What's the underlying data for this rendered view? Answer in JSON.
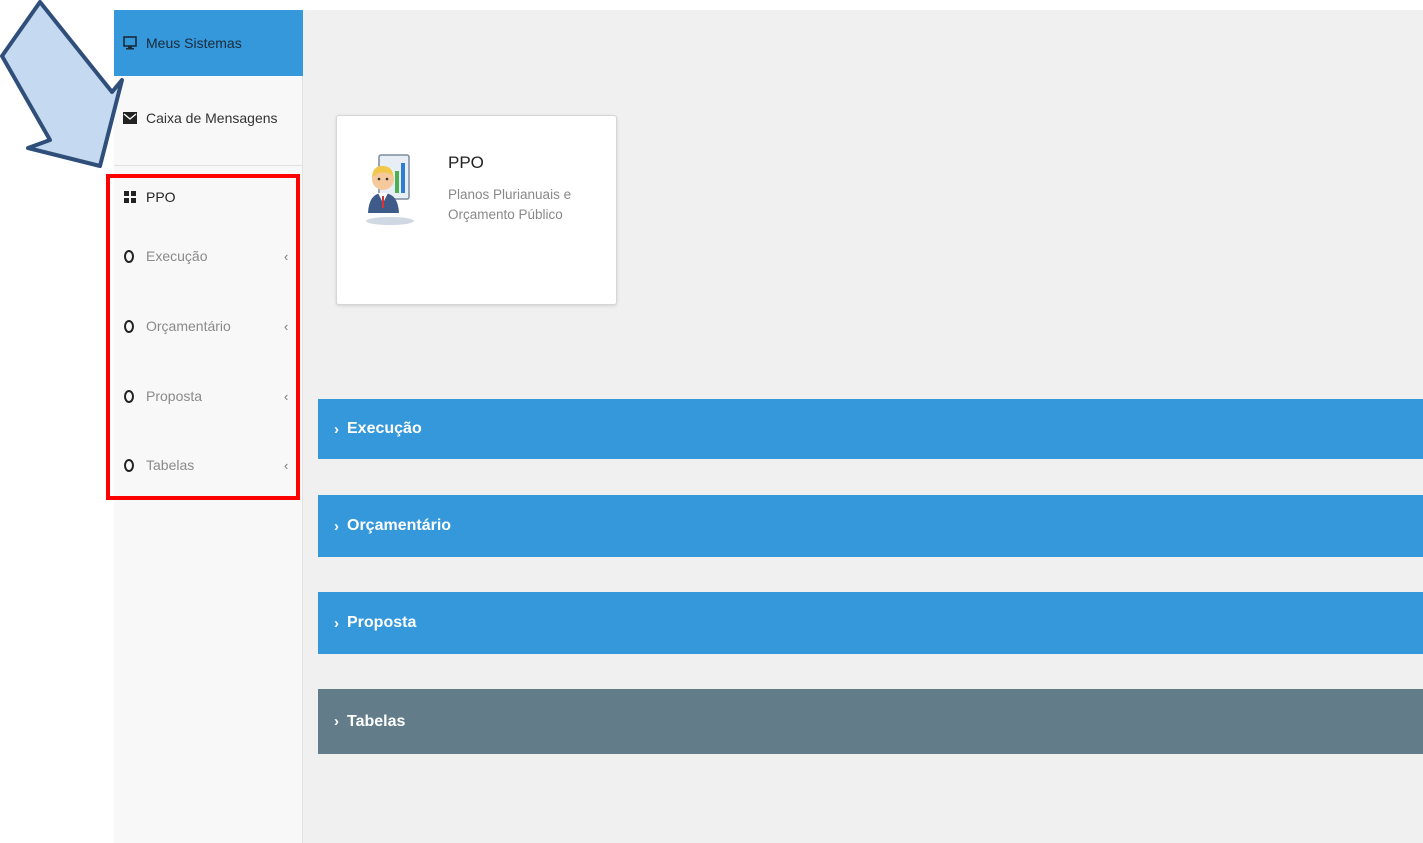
{
  "sidebar": {
    "meus_sistemas": "Meus Sistemas",
    "caixa_mensagens": "Caixa de Mensagens",
    "ppo": "PPO",
    "items": [
      {
        "label": "Execução"
      },
      {
        "label": "Orçamentário"
      },
      {
        "label": "Proposta"
      },
      {
        "label": "Tabelas"
      }
    ]
  },
  "card": {
    "title": "PPO",
    "description": "Planos Plurianuais e Orçamento Público"
  },
  "sections": [
    {
      "label": "Execução"
    },
    {
      "label": "Orçamentário"
    },
    {
      "label": "Proposta"
    },
    {
      "label": "Tabelas"
    }
  ],
  "colors": {
    "accent": "#3498db",
    "section_gray": "#627c8a",
    "highlight_border": "#ff0000",
    "annotation_arrow": "#c5d9f0"
  },
  "icons": {
    "meus_sistemas": "monitor-icon",
    "caixa_mensagens": "envelope-icon",
    "ppo": "grid-icon",
    "sub_items": "circle-icon",
    "expand": "chevron-left-icon",
    "sections": "chevron-right-icon"
  }
}
